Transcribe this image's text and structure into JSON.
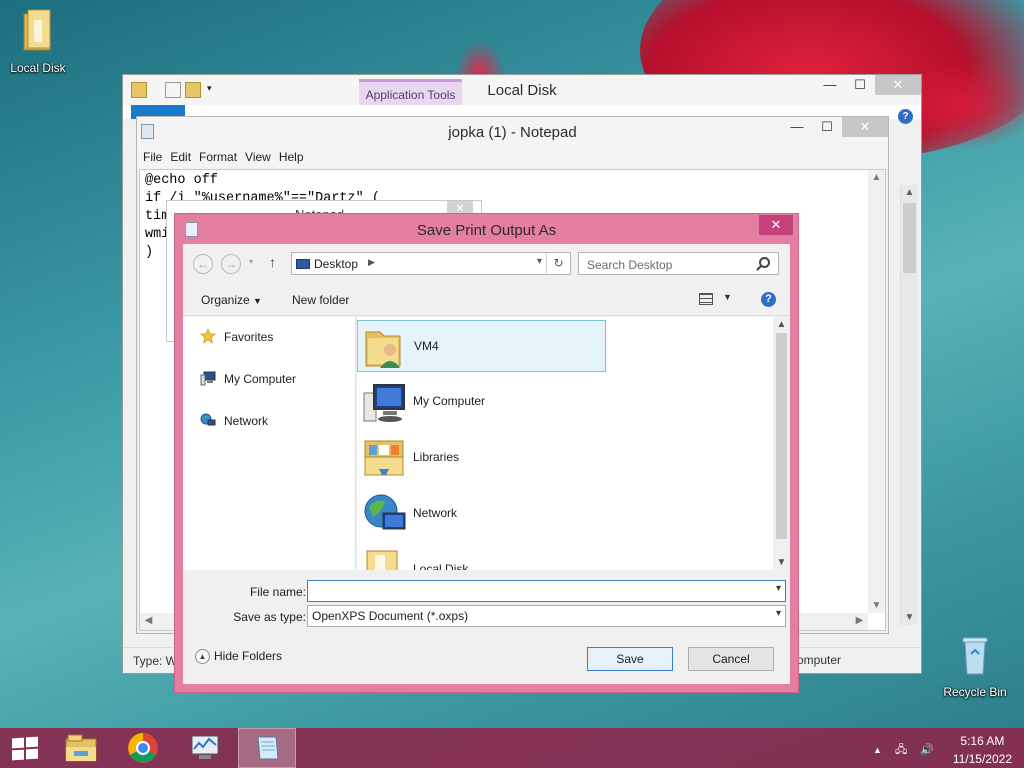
{
  "desktop": {
    "icons": [
      {
        "label": "Local Disk"
      },
      {
        "label": "Recycle Bin"
      }
    ]
  },
  "explorer": {
    "title": "Local Disk",
    "app_tools_label": "Application Tools",
    "status_left": "Type: W",
    "status_right": "omputer"
  },
  "notepad": {
    "title": "jopka (1) - Notepad",
    "menu": [
      "File",
      "Edit",
      "Format",
      "View",
      "Help"
    ],
    "code_lines": [
      "@echo off",
      "if /i \"%username%\"==\"Dartz\" (",
      "tim",
      "wmi",
      ")"
    ],
    "ghost_title": "Notepad"
  },
  "dialog": {
    "title": "Save Print Output As",
    "address": "Desktop",
    "search_placeholder": "Search Desktop",
    "organize_label": "Organize",
    "new_folder_label": "New folder",
    "nav_items": [
      "Favorites",
      "My Computer",
      "Network"
    ],
    "files": [
      "VM4",
      "My Computer",
      "Libraries",
      "Network",
      "Local Disk"
    ],
    "file_name_label": "File name:",
    "file_name_value": "",
    "save_type_label": "Save as type:",
    "save_type_value": "OpenXPS Document (*.oxps)",
    "hide_folders_label": "Hide Folders",
    "save_label": "Save",
    "cancel_label": "Cancel"
  },
  "taskbar": {
    "time": "5:16 AM",
    "date": "11/15/2022"
  },
  "colors": {
    "dialog_border": "#e57fa1",
    "taskbar": "#882c50",
    "accent_blue": "#3c7fc4"
  }
}
